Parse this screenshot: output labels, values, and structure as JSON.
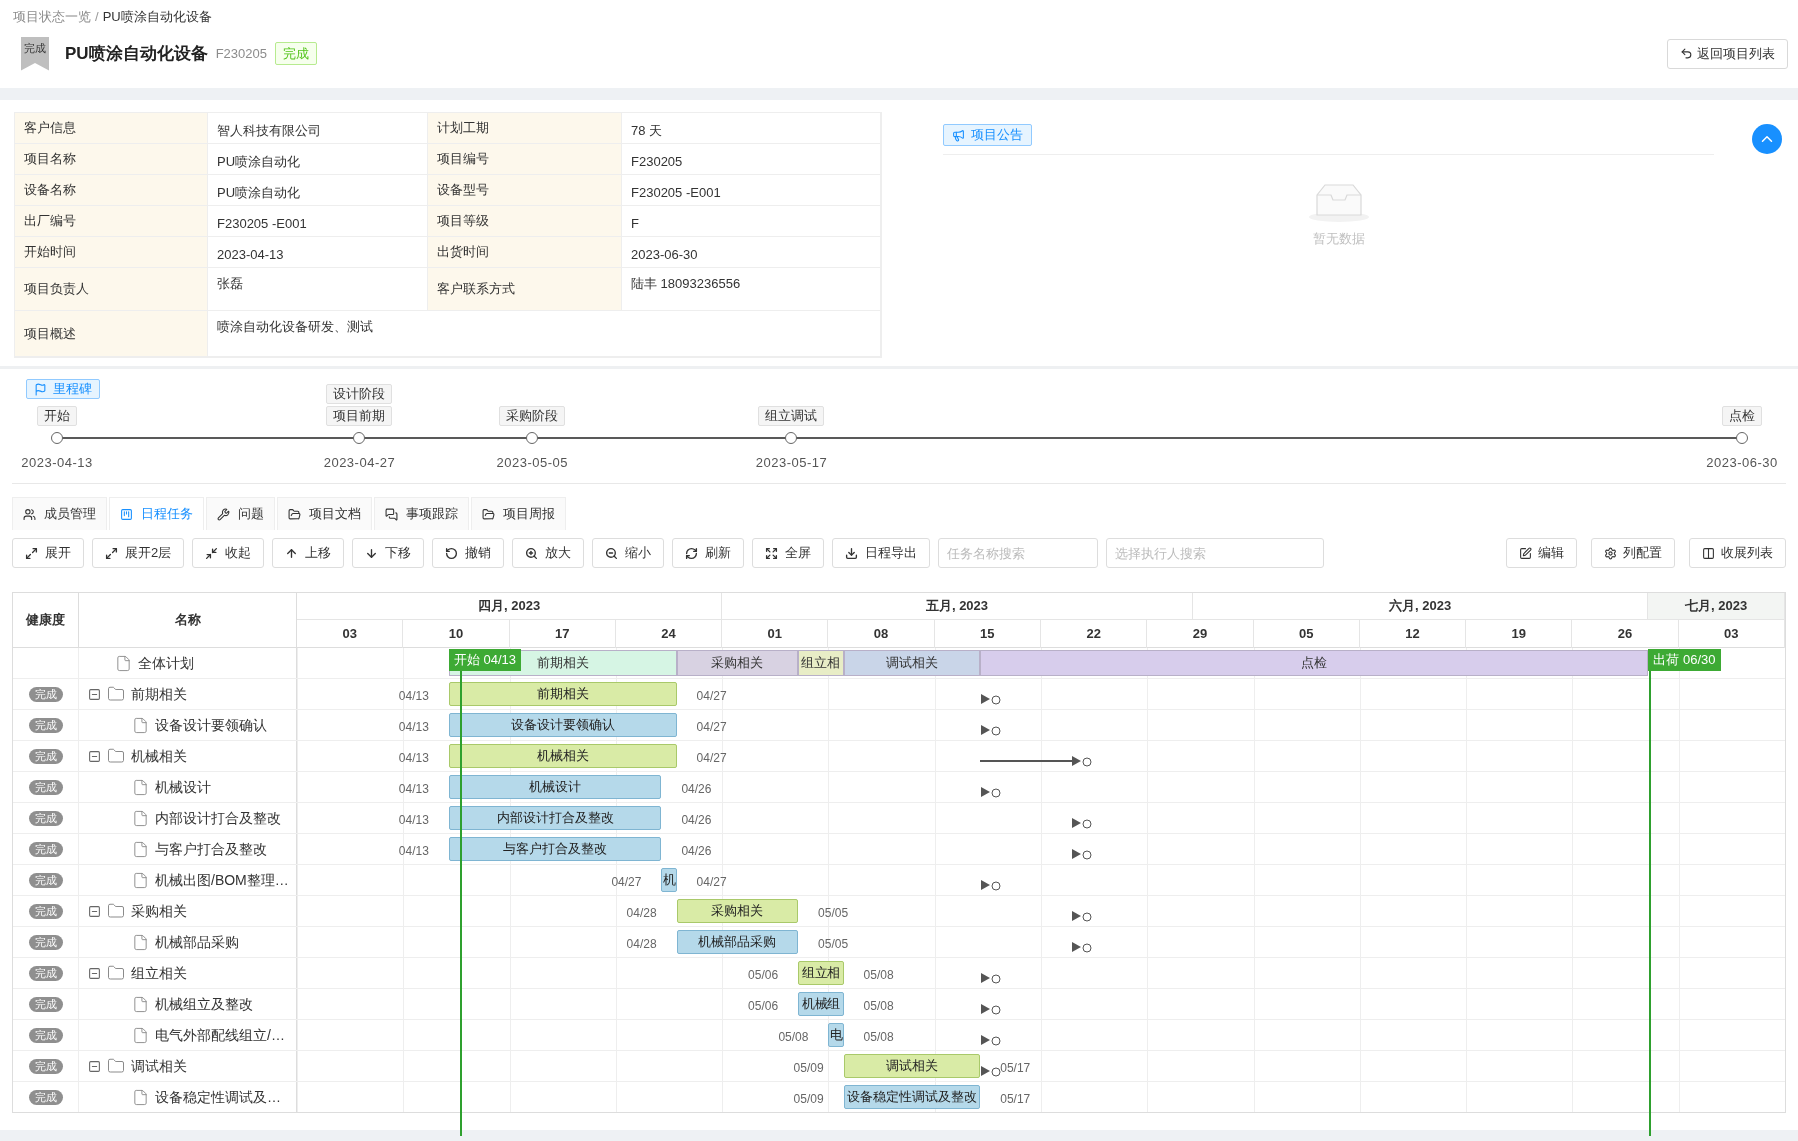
{
  "breadcrumb": {
    "items": [
      "项目状态一览",
      "PU喷涂自动化设备"
    ],
    "separator": "/"
  },
  "header": {
    "ribbon": "完成",
    "title": "PU喷涂自动化设备",
    "code": "F230205",
    "status": "完成",
    "back_button": "返回项目列表"
  },
  "info": {
    "rows": [
      [
        {
          "label": "客户信息",
          "value": "智人科技有限公司"
        },
        {
          "label": "计划工期",
          "value": "78 天"
        }
      ],
      [
        {
          "label": "项目名称",
          "value": "PU喷涂自动化"
        },
        {
          "label": "项目编号",
          "value": "F230205"
        }
      ],
      [
        {
          "label": "设备名称",
          "value": "PU喷涂自动化"
        },
        {
          "label": "设备型号",
          "value": "F230205 -E001"
        }
      ],
      [
        {
          "label": "出厂编号",
          "value": "F230205 -E001"
        },
        {
          "label": "项目等级",
          "value": "F"
        }
      ],
      [
        {
          "label": "开始时间",
          "value": "2023-04-13"
        },
        {
          "label": "出货时间",
          "value": "2023-06-30"
        }
      ],
      [
        {
          "label": "项目负责人",
          "value": "张磊"
        },
        {
          "label": "客户联系方式",
          "value": "陆丰 18093236556"
        }
      ],
      [
        {
          "label": "项目概述",
          "value": "喷涂自动化设备研发、测试"
        }
      ]
    ]
  },
  "announcement": {
    "tag": "项目公告",
    "empty_text": "暂无数据"
  },
  "milestones": {
    "tag": "里程碑",
    "items": [
      {
        "labels": [
          "开始"
        ],
        "date": "2023-04-13"
      },
      {
        "labels": [
          "设计阶段",
          "项目前期"
        ],
        "date": "2023-04-27"
      },
      {
        "labels": [
          "采购阶段"
        ],
        "date": "2023-05-05"
      },
      {
        "labels": [
          "组立调试"
        ],
        "date": "2023-05-17"
      },
      {
        "labels": [
          "点检"
        ],
        "date": "2023-06-30"
      }
    ]
  },
  "tabs": [
    {
      "label": "成员管理",
      "selected": false
    },
    {
      "label": "日程任务",
      "selected": true
    },
    {
      "label": "问题",
      "selected": false
    },
    {
      "label": "项目文档",
      "selected": false
    },
    {
      "label": "事项跟踪",
      "selected": false
    },
    {
      "label": "项目周报",
      "selected": false
    }
  ],
  "toolbar": {
    "buttons": [
      "展开",
      "展开2层",
      "收起",
      "上移",
      "下移",
      "撤销",
      "放大",
      "缩小",
      "刷新",
      "全屏",
      "日程导出"
    ],
    "search_fields": [
      {
        "placeholder": "任务名称搜索"
      },
      {
        "placeholder": "选择执行人搜索"
      }
    ],
    "right_buttons": [
      "编辑",
      "列配置",
      "收展列表"
    ]
  },
  "gantt": {
    "columns": [
      "健康度",
      "名称"
    ],
    "months": [
      "四月, 2023",
      "五月, 2023",
      "六月, 2023",
      "七月, 2023"
    ],
    "weeks": [
      "03",
      "10",
      "17",
      "24",
      "01",
      "08",
      "15",
      "22",
      "29",
      "05",
      "12",
      "19",
      "26",
      "03"
    ],
    "start_tag": "开始 04/13",
    "end_tag": "出荷 06/30",
    "tree": [
      {
        "name": "全体计划",
        "kind": "summary",
        "segments": [
          {
            "label": "前期相关",
            "kind": "phase",
            "color": "#d6f5e4"
          },
          {
            "label": "采购相关",
            "kind": "phase",
            "color": "#d8d2e2"
          },
          {
            "label": "组立相",
            "kind": "phase",
            "color": "#e8edc6"
          },
          {
            "label": "调试相关",
            "kind": "phase",
            "color": "#c9d5e8"
          },
          {
            "label": "点检",
            "kind": "final",
            "color": "#d7cdec"
          }
        ],
        "children": [
          {
            "name": "前期相关",
            "kind": "group",
            "expanded": true,
            "health": "完成",
            "start": "04/13",
            "end": "04/27",
            "bar_label": "前期相关",
            "marker": {
              "kind": "near"
            },
            "children": [
              {
                "name": "设备设计要领确认",
                "kind": "task",
                "health": "完成",
                "start": "04/13",
                "end": "04/27",
                "bar_label": "设备设计要领确认",
                "marker": {
                  "kind": "near"
                }
              }
            ]
          },
          {
            "name": "机械相关",
            "kind": "group",
            "expanded": true,
            "health": "完成",
            "start": "04/13",
            "end": "04/27",
            "bar_label": "机械相关",
            "marker": {
              "kind": "range"
            },
            "children": [
              {
                "name": "机械设计",
                "kind": "task",
                "health": "完成",
                "start": "04/13",
                "end": "04/26",
                "bar_label": "机械设计",
                "marker": {
                  "kind": "near"
                }
              },
              {
                "name": "内部设计打合及整改",
                "kind": "task",
                "health": "完成",
                "start": "04/13",
                "end": "04/26",
                "bar_label": "内部设计打合及整改",
                "marker": {
                  "kind": "far"
                }
              },
              {
                "name": "与客户打合及整改",
                "kind": "task",
                "health": "完成",
                "start": "04/13",
                "end": "04/26",
                "bar_label": "与客户打合及整改",
                "marker": {
                  "kind": "far"
                }
              },
              {
                "name": "机械出图/BOM整理…",
                "kind": "task",
                "health": "完成",
                "start": "04/27",
                "end": "04/27",
                "bar_label": "机",
                "marker": {
                  "kind": "near"
                }
              }
            ]
          },
          {
            "name": "采购相关",
            "kind": "group",
            "expanded": true,
            "health": "完成",
            "start": "04/28",
            "end": "05/05",
            "bar_label": "采购相关",
            "marker": {
              "kind": "far"
            },
            "children": [
              {
                "name": "机械部品采购",
                "kind": "task",
                "health": "完成",
                "start": "04/28",
                "end": "05/05",
                "bar_label": "机械部品采购",
                "marker": {
                  "kind": "far"
                }
              }
            ]
          },
          {
            "name": "组立相关",
            "kind": "group",
            "expanded": true,
            "health": "完成",
            "start": "05/06",
            "end": "05/08",
            "bar_label": "组立相",
            "marker": {
              "kind": "near"
            },
            "children": [
              {
                "name": "机械组立及整改",
                "kind": "task",
                "health": "完成",
                "start": "05/06",
                "end": "05/08",
                "bar_label": "机械组",
                "marker": {
                  "kind": "near"
                }
              },
              {
                "name": "电气外部配线组立/…",
                "kind": "task",
                "health": "完成",
                "start": "05/08",
                "end": "05/08",
                "bar_label": "电",
                "marker": {
                  "kind": "near"
                }
              }
            ]
          },
          {
            "name": "调试相关",
            "kind": "group",
            "expanded": true,
            "health": "完成",
            "start": "05/09",
            "end": "05/17",
            "bar_label": "调试相关",
            "marker": {
              "kind": "near"
            },
            "children": [
              {
                "name": "设备稳定性调试及…",
                "kind": "task",
                "health": "完成",
                "start": "05/09",
                "end": "05/17",
                "bar_label": "设备稳定性调试及整改"
              }
            ]
          }
        ]
      }
    ]
  }
}
